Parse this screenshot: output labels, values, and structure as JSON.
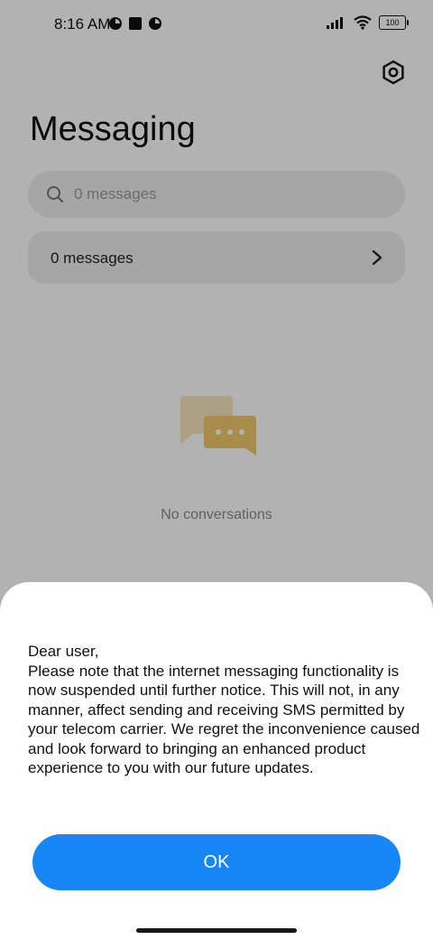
{
  "status_bar": {
    "time": "8:16 AM",
    "battery": "100",
    "icons_left": [
      "notification-icon",
      "square-app-icon",
      "notification-icon-2"
    ],
    "icons_right": [
      "signal-icon",
      "wifi-icon",
      "battery-icon"
    ]
  },
  "header": {
    "title": "Messaging",
    "settings_icon": "settings-icon"
  },
  "search": {
    "placeholder": "0 messages",
    "icon": "search-icon"
  },
  "summary_row": {
    "label": "0 messages",
    "icon": "chevron-right-icon"
  },
  "empty_state": {
    "icon": "chat-bubbles-icon",
    "text": "No conversations"
  },
  "dialog": {
    "message": "Dear user,\nPlease note that the internet messaging functionality is now suspended until further notice. This will not, in any manner, affect sending and receiving SMS permitted by your telecom carrier. We regret the inconvenience caused and look forward to bringing an enhanced product experience to you with our future updates.",
    "ok_label": "OK"
  },
  "colors": {
    "accent": "#1787f7",
    "overlay": "rgba(0,0,0,0.30)",
    "illustration": "#f2c86b"
  }
}
